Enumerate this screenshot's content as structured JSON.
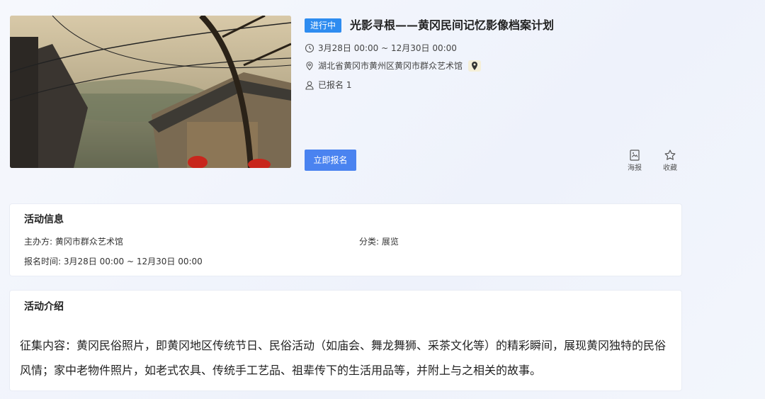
{
  "event": {
    "status": "进行中",
    "title": "光影寻根——黄冈民间记忆影像档案计划",
    "time": "3月28日 00:00 ~ 12月30日 00:00",
    "location": "湖北省黄冈市黄州区黄冈市群众艺术馆",
    "signups": "已报名 1"
  },
  "actions": {
    "register": "立即报名",
    "poster": "海报",
    "favorite": "收藏"
  },
  "info": {
    "title": "活动信息",
    "organizer_label": "主办方:",
    "organizer": "黄冈市群众艺术馆",
    "category_label": "分类:",
    "category": "展览",
    "signup_time_label": "报名时间:",
    "signup_time": "3月28日 00:00 ~ 12月30日 00:00"
  },
  "intro": {
    "title": "活动介绍",
    "text": "征集内容：黄冈民俗照片，即黄冈地区传统节日、民俗活动（如庙会、舞龙舞狮、采茶文化等）的精彩瞬间，展现黄冈独特的民俗风情；家中老物件照片，如老式农具、传统手工艺品、祖辈传下的生活用品等，并附上与之相关的故事。"
  },
  "colors": {
    "status_badge": "#2e8cf0",
    "primary_button": "#4a83f0"
  },
  "icons": [
    "clock-icon",
    "location-icon",
    "map-pin-icon",
    "user-icon",
    "poster-icon",
    "star-icon"
  ]
}
